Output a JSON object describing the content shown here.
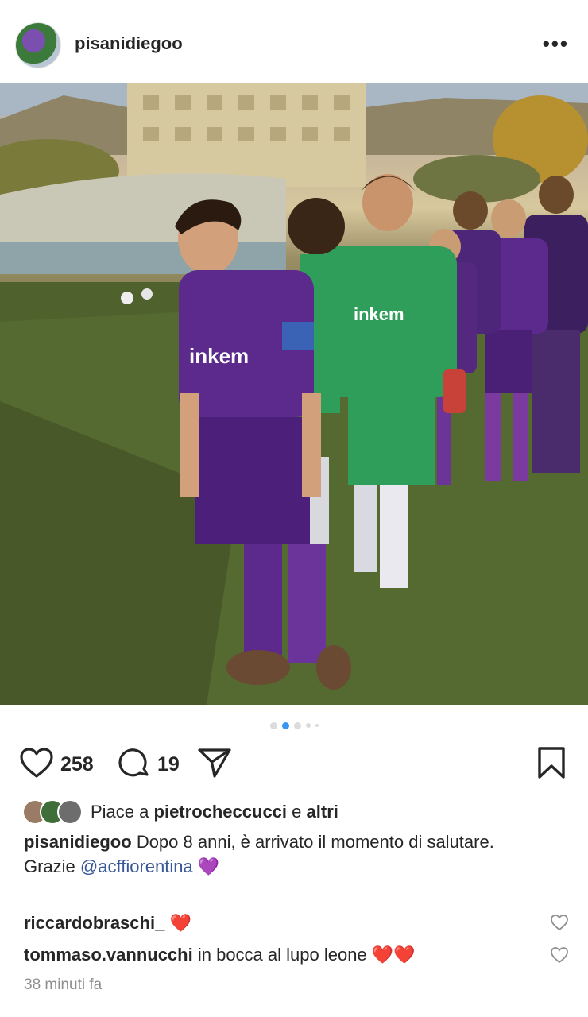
{
  "post": {
    "username": "pisanidiegoo",
    "more_icon": "•••"
  },
  "actions": {
    "likes": "258",
    "comments": "19"
  },
  "liked_by": {
    "prefix": "Piace a",
    "user": "pietrocheccucci",
    "conj": "e",
    "others": "altri"
  },
  "caption": {
    "author": "pisanidiegoo",
    "text_line1": "Dopo 8 anni, è arrivato il momento di salutare.",
    "text_line2_prefix": "Grazie",
    "mention": "@acffiorentina",
    "emoji": "💜"
  },
  "comments": [
    {
      "user": "riccardobraschi_",
      "text": "❤️"
    },
    {
      "user": "tommaso.vannucchi",
      "text": "in bocca al lupo leone ❤️❤️"
    }
  ],
  "timestamp": "38 minuti fa",
  "jersey_sponsor": "inkem",
  "colors": {
    "accent": "#3897f0",
    "purple": "#5b2a8c",
    "green": "#2f9e5b",
    "heart": "#e0243c"
  }
}
